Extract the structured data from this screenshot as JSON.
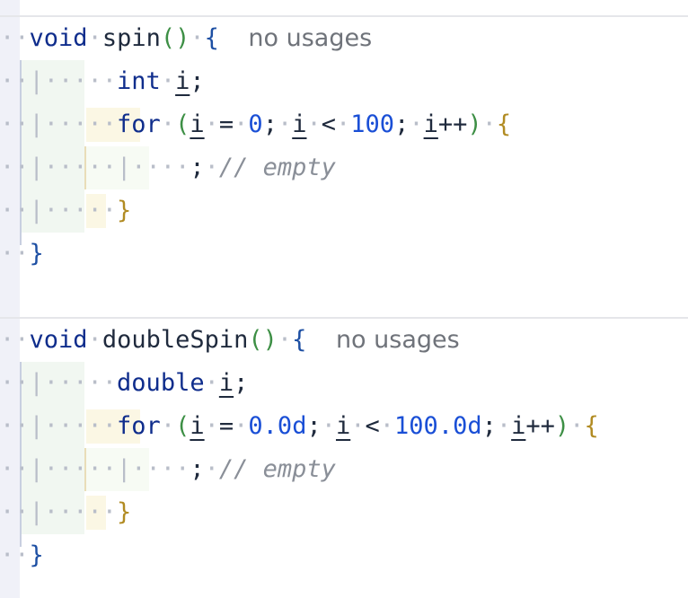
{
  "methods": [
    {
      "header": {
        "return_type": "void",
        "name": "spin",
        "parens": "()",
        "open_brace": "{",
        "usage_hint": "no usages"
      },
      "decl": {
        "type": "int",
        "var": "i",
        "semi": ";"
      },
      "loop": {
        "keyword": "for",
        "open_paren": "(",
        "var1": "i",
        "assign": "=",
        "init": "0",
        "semi1": ";",
        "var2": "i",
        "lt": "<",
        "limit": "100",
        "semi2": ";",
        "var3": "i",
        "incr": "++",
        "close_paren": ")",
        "open_brace": "{"
      },
      "body": {
        "semi": ";",
        "comment": "// empty"
      },
      "loop_close": "}",
      "method_close": "}"
    },
    {
      "header": {
        "return_type": "void",
        "name": "doubleSpin",
        "parens": "()",
        "open_brace": "{",
        "usage_hint": "no usages"
      },
      "decl": {
        "type": "double",
        "var": "i",
        "semi": ";"
      },
      "loop": {
        "keyword": "for",
        "open_paren": "(",
        "var1": "i",
        "assign": "=",
        "init": "0.0d",
        "semi1": ";",
        "var2": "i",
        "lt": "<",
        "limit": "100.0d",
        "semi2": ";",
        "var3": "i",
        "incr": "++",
        "close_paren": ")",
        "open_brace": "{"
      },
      "body": {
        "semi": ";",
        "comment": "// empty"
      },
      "loop_close": "}",
      "method_close": "}"
    }
  ]
}
